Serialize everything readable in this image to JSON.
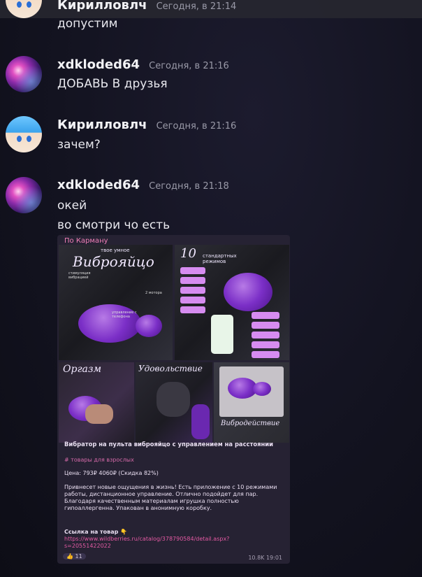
{
  "messages": [
    {
      "author": "Кирилловлч",
      "time": "Сегодня, в 21:14",
      "text": "допустим"
    },
    {
      "author": "xdkloded64",
      "time": "Сегодня, в 21:16",
      "text": "ДОБАВЬ В друзья"
    },
    {
      "author": "Кирилловлч",
      "time": "Сегодня, в 21:16",
      "text": "зачем?"
    },
    {
      "author": "xdkloded64",
      "time": "Сегодня, в 21:18",
      "text": "окей",
      "text2": "во смотри чо есть"
    }
  ],
  "post": {
    "source": "По Карману",
    "tiles": {
      "t1_small": "твое умное",
      "t1_title": "Виброяйцо",
      "t1_label1": "стимуляция вибрацией",
      "t1_label2": "2 мотора",
      "t1_label3": "управление с телефона",
      "t2_num": "10",
      "t2_title": "стандартных режимов",
      "t3_title": "Оргазм",
      "t4_title": "Удовольствие",
      "t5_title": "Вибродействие"
    },
    "title": "Вибратор на пульта виброяйцо с управлением на расстоянии",
    "tag": "# товары для взрослых",
    "price": "Цена: 793₽ 4060₽ (Скидка 82%)",
    "description": "Привнесет новые ощущения в жизнь! Есть приложение с 10 режимами работы, дистанционное управление. Отлично подойдет для пар. Благодаря качественным материалам игрушка полностью гипоаллергенна. Упакован в анонимную коробку.",
    "link_label": "Ссылка на товар 👇",
    "link": "https://www.wildberries.ru/catalog/378790584/detail.aspx?s=20551422022",
    "reactions": "👍 11",
    "views": "10.8K  19:01"
  }
}
